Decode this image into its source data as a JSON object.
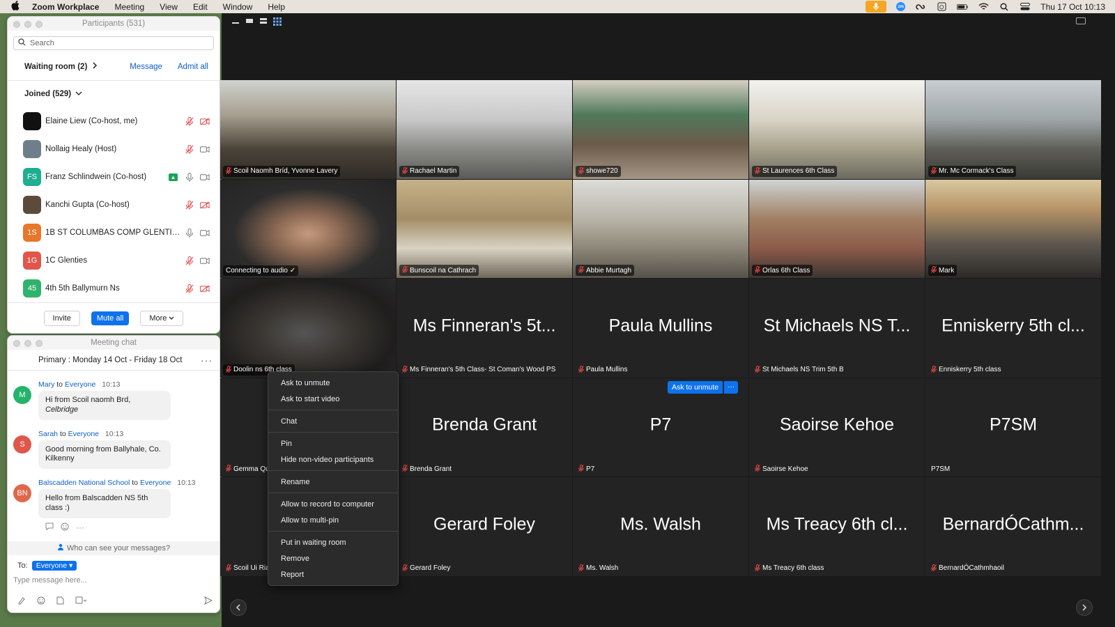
{
  "menubar": {
    "app": "Zoom Workplace",
    "menus": [
      "Meeting",
      "View",
      "Edit",
      "Window",
      "Help"
    ],
    "clock": "Thu 17 Oct  10:13",
    "icons": [
      "mic-icon",
      "zoom-icon",
      "creative-cloud-icon",
      "office-icon",
      "battery-icon",
      "wifi-icon",
      "spotlight-search-icon",
      "control-center-icon"
    ]
  },
  "participants": {
    "title": "Participants (531)",
    "search_placeholder": "Search",
    "waiting_room": "Waiting room (2)",
    "message": "Message",
    "admit_all": "Admit all",
    "joined": "Joined (529)",
    "list": [
      {
        "name": "Elaine Liew (Co-host, me)",
        "initials": "",
        "color": "#111111"
      },
      {
        "name": "Nollaig Healy (Host)",
        "initials": "",
        "color": "#6f7f8a"
      },
      {
        "name": "Franz Schlindwein (Co-host)",
        "initials": "FS",
        "color": "#1fae8f"
      },
      {
        "name": "Kanchi Gupta (Co-host)",
        "initials": "",
        "color": "#5c4b3b"
      },
      {
        "name": "1B ST COLUMBAS COMP GLENTIES...",
        "initials": "1S",
        "color": "#e8772b"
      },
      {
        "name": "1C Glenties",
        "initials": "1G",
        "color": "#e0564a"
      },
      {
        "name": "4th 5th Ballymurn Ns",
        "initials": "45",
        "color": "#2fb36b"
      }
    ],
    "invite": "Invite",
    "mute_all": "Mute all",
    "more": "More"
  },
  "chat": {
    "title": "Meeting chat",
    "header": "Primary : Monday 14 Oct - Friday 18 Oct",
    "messages": [
      {
        "from": "Mary",
        "to": "Everyone",
        "time": "10:13",
        "initials": "M",
        "color": "#24b36b",
        "text_plain": "Hi from Scoil naomh Brd, ",
        "text_italic": "Celbridge"
      },
      {
        "from": "Sarah",
        "to": "Everyone",
        "time": "10:13",
        "initials": "S",
        "color": "#e0564a",
        "text": "Good morning from Ballyhale, Co. Kilkenny"
      },
      {
        "from": "Balscadden National School",
        "to": "Everyone",
        "time": "10:13",
        "initials": "BN",
        "color": "#e0674a",
        "text": "Hello from Balscadden NS 5th class :)"
      }
    ],
    "to_word": "to",
    "who_can_see": "Who can see your messages?",
    "to_label": "To:",
    "to_value": "Everyone",
    "input_placeholder": "Type message here..."
  },
  "tiles": [
    {
      "label": "Scoil Naomh Bríd, Yvonne Lavery"
    },
    {
      "label": "Rachael Martin"
    },
    {
      "label": "showe720"
    },
    {
      "label": "St Laurences 6th Class"
    },
    {
      "label": "Mr. Mc Cormack's Class"
    },
    {
      "label": "Connecting to audio ✓"
    },
    {
      "label": "Bunscoil na Cathrach"
    },
    {
      "label": "Abbie Murtagh"
    },
    {
      "label": "Orlas 6th Class"
    },
    {
      "label": "Mark"
    },
    {
      "label": "Doolin ns 6th class"
    },
    {
      "big": "Ms Finneran's 5t...",
      "label": "Ms Finneran's 5th Class- St Coman's Wood PS"
    },
    {
      "big": "Paula Mullins",
      "label": "Paula Mullins"
    },
    {
      "big": "St Michaels NS T...",
      "label": "St Michaels NS Trim 5th B"
    },
    {
      "big": "Enniskerry 5th cl...",
      "label": "Enniskerry 5th class"
    },
    {
      "big": "Ge",
      "label": "Gemma Qui"
    },
    {
      "big": "Brenda Grant",
      "label": "Brenda Grant"
    },
    {
      "big": "P7",
      "label": "P7"
    },
    {
      "big": "Saoirse Kehoe",
      "label": "Saoirse Kehoe"
    },
    {
      "big": "P7SM",
      "label": "P7SM"
    },
    {
      "big": "Sc",
      "label": "Scoil Ui Riac"
    },
    {
      "big": "Gerard Foley",
      "label": "Gerard Foley"
    },
    {
      "big": "Ms. Walsh",
      "label": "Ms. Walsh"
    },
    {
      "big": "Ms Treacy 6th cl...",
      "label": "Ms Treacy 6th class"
    },
    {
      "big": "BernardÓCathm...",
      "label": "BernardÓCathmhaoil"
    }
  ],
  "ask_to_unmute": "Ask to unmute",
  "ask_more": "···",
  "context_menu": {
    "groups": [
      [
        "Ask to unmute",
        "Ask to start video"
      ],
      [
        "Chat"
      ],
      [
        "Pin",
        "Hide non-video participants"
      ],
      [
        "Rename"
      ],
      [
        "Allow to record to computer",
        "Allow to multi-pin"
      ],
      [
        "Put in waiting room",
        "Remove",
        "Report"
      ]
    ]
  },
  "colors": {
    "accent": "#0e72ed",
    "muted_red": "#e04646",
    "meeting_bg": "#1a1a1a"
  }
}
